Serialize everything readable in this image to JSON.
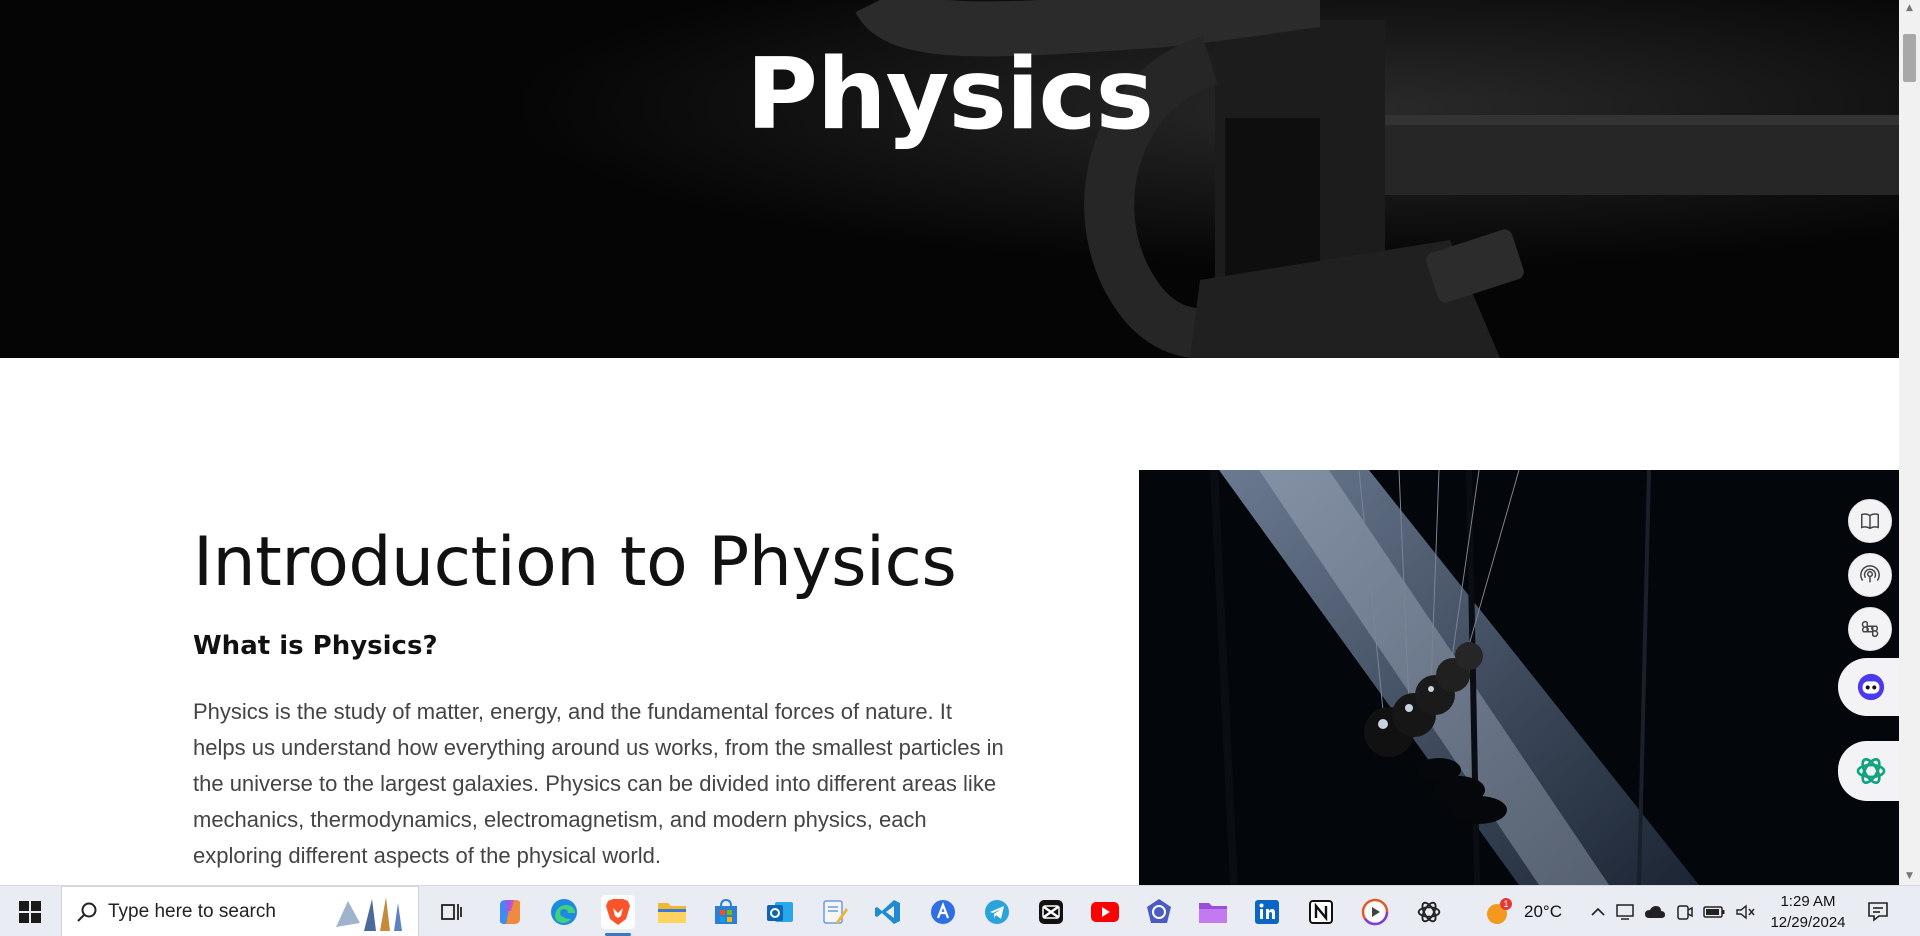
{
  "hero": {
    "title": "Physics"
  },
  "intro": {
    "heading": "Introduction to Physics",
    "subheading": "What is Physics?",
    "body": "Physics is the study of matter, energy, and the fundamental forces of nature. It helps us understand how everything around us works, from the smallest particles in the universe to the largest galaxies. Physics can be divided into different areas like mechanics, thermodynamics, electromagnetism, and modern physics, each exploring different aspects of the physical world."
  },
  "side_panel": {
    "buttons": [
      "book-icon",
      "broadcast-icon",
      "command-icon",
      "assistant-face-icon",
      "chatgpt-icon"
    ]
  },
  "taskbar": {
    "search_placeholder": "Type here to search",
    "pinned_apps": [
      "task-view",
      "copilot",
      "edge",
      "brave",
      "file-explorer",
      "microsoft-store",
      "outlook",
      "notepad",
      "vs-code",
      "arc",
      "telegram",
      "capcut",
      "youtube",
      "apps-hub",
      "folder",
      "linkedin",
      "notion",
      "media-player",
      "chatgpt"
    ],
    "active_app": "brave",
    "weather": {
      "temp": "20°C",
      "badge": "1"
    },
    "clock": {
      "time": "1:29 AM",
      "date": "12/29/2024"
    }
  },
  "colors": {
    "hero_bg": "#050505",
    "heading": "#111111",
    "body_text": "#444444",
    "taskbar_bg": "#e9edf3",
    "accent": "#3b77c4"
  }
}
